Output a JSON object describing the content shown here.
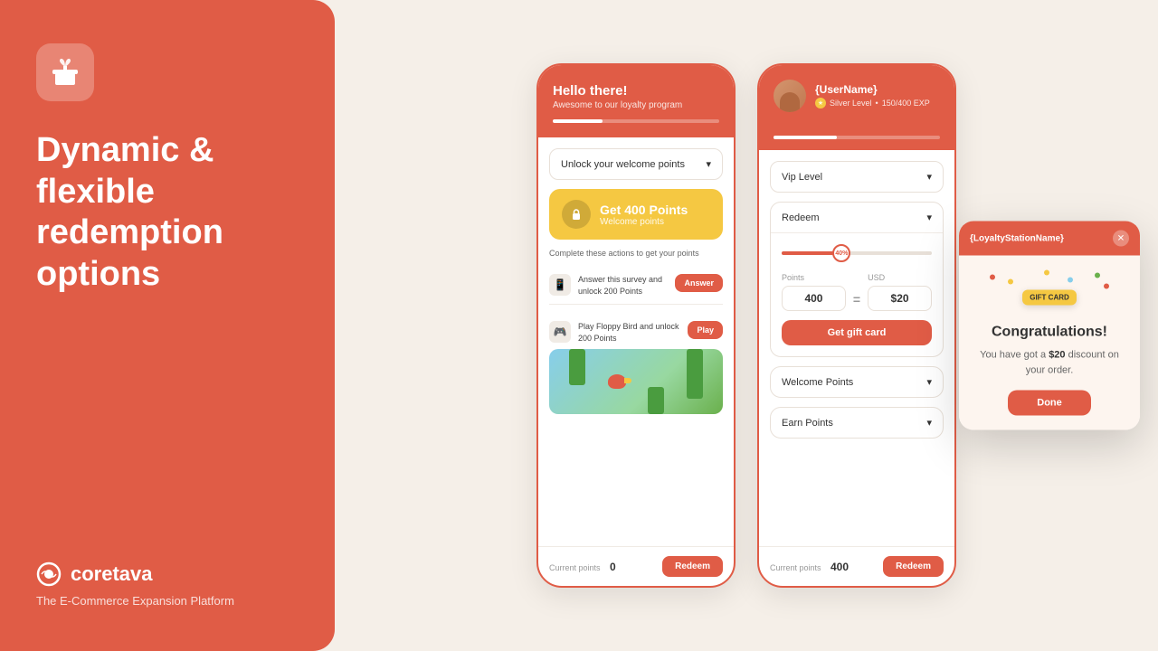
{
  "leftPanel": {
    "heading": "Dynamic & flexible redemption options",
    "brand": "coretava",
    "tagline": "The E-Commerce Expansion Platform"
  },
  "phone1": {
    "header": {
      "greeting": "Hello there!",
      "subGreeting": "Awesome to our loyalty program"
    },
    "dropdown": {
      "label": "Unlock your welcome points"
    },
    "welcomeCard": {
      "getPoints": "Get 400 Points",
      "pointsLabel": "Welcome points"
    },
    "actionsLabel": "Complete these actions to get your points",
    "actions": [
      {
        "icon": "📱",
        "text": "Answer this survey and unlock 200 Points",
        "btnLabel": "Answer"
      },
      {
        "icon": "🎮",
        "text": "Play Floppy Bird and unlock 200 Points",
        "btnLabel": "Play"
      }
    ],
    "footer": {
      "label": "Current points",
      "value": "0",
      "btnLabel": "Redeem"
    }
  },
  "phone2": {
    "header": {
      "username": "{UserName}",
      "level": "Silver Level",
      "exp": "150/400 EXP"
    },
    "vipDropdown": "Vip Level",
    "redeem": {
      "label": "Redeem",
      "sliderPercent": 40,
      "points": "400",
      "usd": "$20",
      "btnLabel": "Get gift card"
    },
    "welcomePoints": "Welcome Points",
    "earnPoints": "Earn Points",
    "footer": {
      "label": "Current points",
      "value": "400",
      "btnLabel": "Redeem"
    }
  },
  "popup": {
    "stationName": "{LoyaltyStationName}",
    "title": "Congratulations!",
    "desc": "You have got a",
    "amount": "$20",
    "descSuffix": "discount on your order.",
    "doneBtn": "Done",
    "giftCardLabel": "GIFT CARD"
  },
  "colors": {
    "primary": "#e05c46",
    "yellow": "#f5c842",
    "bg": "#f5efe8"
  }
}
